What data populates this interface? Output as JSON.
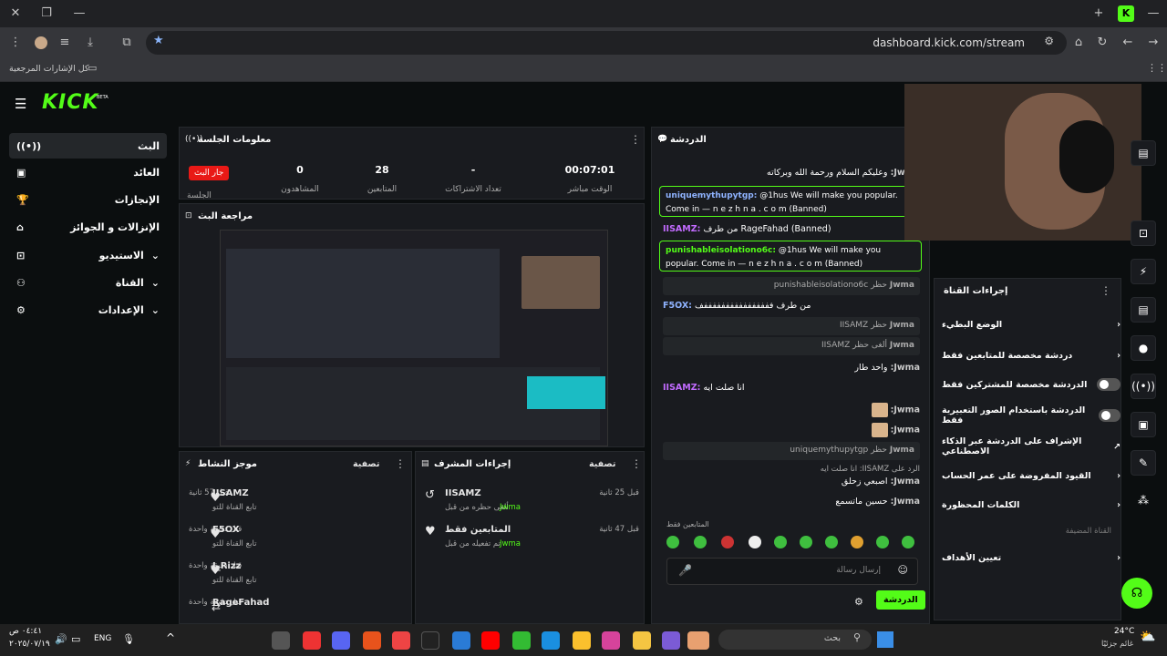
{
  "browser": {
    "url": "dashboard.kick.com/stream",
    "bookmarks_label": "كل الإشارات المرجعية"
  },
  "brand": {
    "logo": "KICK",
    "beta": "BETA",
    "accent": "#53fc18"
  },
  "sidebar": {
    "items": [
      {
        "label": "البث",
        "icon": "broadcast-icon"
      },
      {
        "label": "العائد",
        "icon": "revenue-icon"
      },
      {
        "label": "الإنجازات",
        "icon": "trophy-icon"
      },
      {
        "label": "الإنزالات و الجوائز",
        "icon": "drops-icon"
      },
      {
        "label": "الاستيديو",
        "icon": "chevron-down-icon"
      },
      {
        "label": "القناة",
        "icon": "chevron-down-icon"
      },
      {
        "label": "الإعدادات",
        "icon": "chevron-down-icon"
      }
    ]
  },
  "session": {
    "title": "معلومات الجلسة",
    "live": "جار البث",
    "session_label": "الجلسة",
    "stats": [
      {
        "value": "00:07:01",
        "label": "الوقت مباشر"
      },
      {
        "value": "-",
        "label": "تعداد الاشتراكات"
      },
      {
        "value": "28",
        "label": "المتابعين"
      },
      {
        "value": "0",
        "label": "المشاهدون"
      }
    ]
  },
  "preview": {
    "title": "مراجعة البث"
  },
  "activity": {
    "title": "موجز النشاط",
    "filter": "تصفية",
    "items": [
      {
        "name": "IISAMZ",
        "sub": "تابع القناة للتو",
        "time": "قبل 57 ثانية"
      },
      {
        "name": "F5OX",
        "sub": "تابع القناة للتو",
        "time": "قبل دقيقة واحدة"
      },
      {
        "name": "I_Rizz",
        "sub": "تابع القناة للتو",
        "time": "قبل دقيقة واحدة"
      },
      {
        "name": "RageFahad",
        "sub": "",
        "time": "قبل دقيقة واحدة"
      }
    ]
  },
  "mod_actions": {
    "title": "إجراءات المشرف",
    "filter": "تصفية",
    "items": [
      {
        "name": "IISAMZ",
        "sub": "ألغى حظره من قبل",
        "by": "Jwma",
        "time": "قبل 25 ثانية"
      },
      {
        "name": "المتابعين فقط",
        "sub": "تم تفعيله من قبل",
        "by": "Jwma",
        "time": "قبل 47 ثانية"
      }
    ]
  },
  "chat": {
    "title": "الدردشة",
    "lines": [
      {
        "user": "Jwma:",
        "text": "وعليكم السلام ورحمة الله وبركاته"
      },
      {
        "user": "uniquemythupytgp:",
        "text": "@1hus We will make you popular. Come in — n e z h n a . c o m (Banned)"
      },
      {
        "user": "IISAMZ:",
        "text": "من طرف RageFahad (Banned)"
      },
      {
        "user": "punishableisolationo6c:",
        "text": "@1hus We will make you popular. Come in — n e z h n a . c o m (Banned)"
      },
      {
        "user": "Jwma",
        "text": "حظر punishableisolationo6c"
      },
      {
        "user": "F5OX:",
        "text": "من طرف ففففففففففففففففف"
      },
      {
        "user": "Jwma",
        "text": "حظر IISAMZ"
      },
      {
        "user": "Jwma",
        "text": "ألغى حظر IISAMZ"
      },
      {
        "user": "Jwma:",
        "text": "واحد طار"
      },
      {
        "user": "IISAMZ:",
        "text": "انا صلت ايه"
      },
      {
        "user": "Jwma:",
        "text": ""
      },
      {
        "user": "Jwma:",
        "text": ""
      },
      {
        "user": "Jwma",
        "text": "حظر uniquemythupytgp"
      },
      {
        "user": "",
        "text": "الرد على IISAMZ: انا صلت ايه"
      },
      {
        "user": "Jwma:",
        "text": "اصبعي زحلق"
      },
      {
        "user": "Jwma:",
        "text": "حسين ماتسمع"
      }
    ],
    "followers_only": "المتابعين فقط",
    "input_placeholder": "إرسال رسالة",
    "send": "الدردشة"
  },
  "channel_actions": {
    "title": "إجراءات القناة",
    "rows": [
      {
        "label": "الوضع البطيء",
        "control": "chevron"
      },
      {
        "label": "دردشة مخصصة للمتابعين فقط",
        "control": "chevron"
      },
      {
        "label": "الدردشة مخصصة للمشتركين فقط",
        "control": "toggle"
      },
      {
        "label": "الدردشة باستخدام الصور التعبيرية فقط",
        "control": "toggle"
      },
      {
        "label": "الإشراف على الدردشة عبر الذكاء الاصطناعي",
        "control": "external"
      },
      {
        "label": "القيود المفروضة على عمر الحساب",
        "control": "chevron"
      },
      {
        "label": "الكلمات المحظورة",
        "control": "chevron"
      }
    ],
    "section": "القناة المضيفة",
    "hosting": "تعيين الأهداف"
  },
  "taskbar": {
    "time": "٠٤:٤١ ص",
    "date": "٢٠٢٥/٠٧/١٩",
    "lang": "ENG",
    "search": "بحث",
    "weather_temp": "24°C",
    "weather_desc": "غائم جزئيًا"
  }
}
